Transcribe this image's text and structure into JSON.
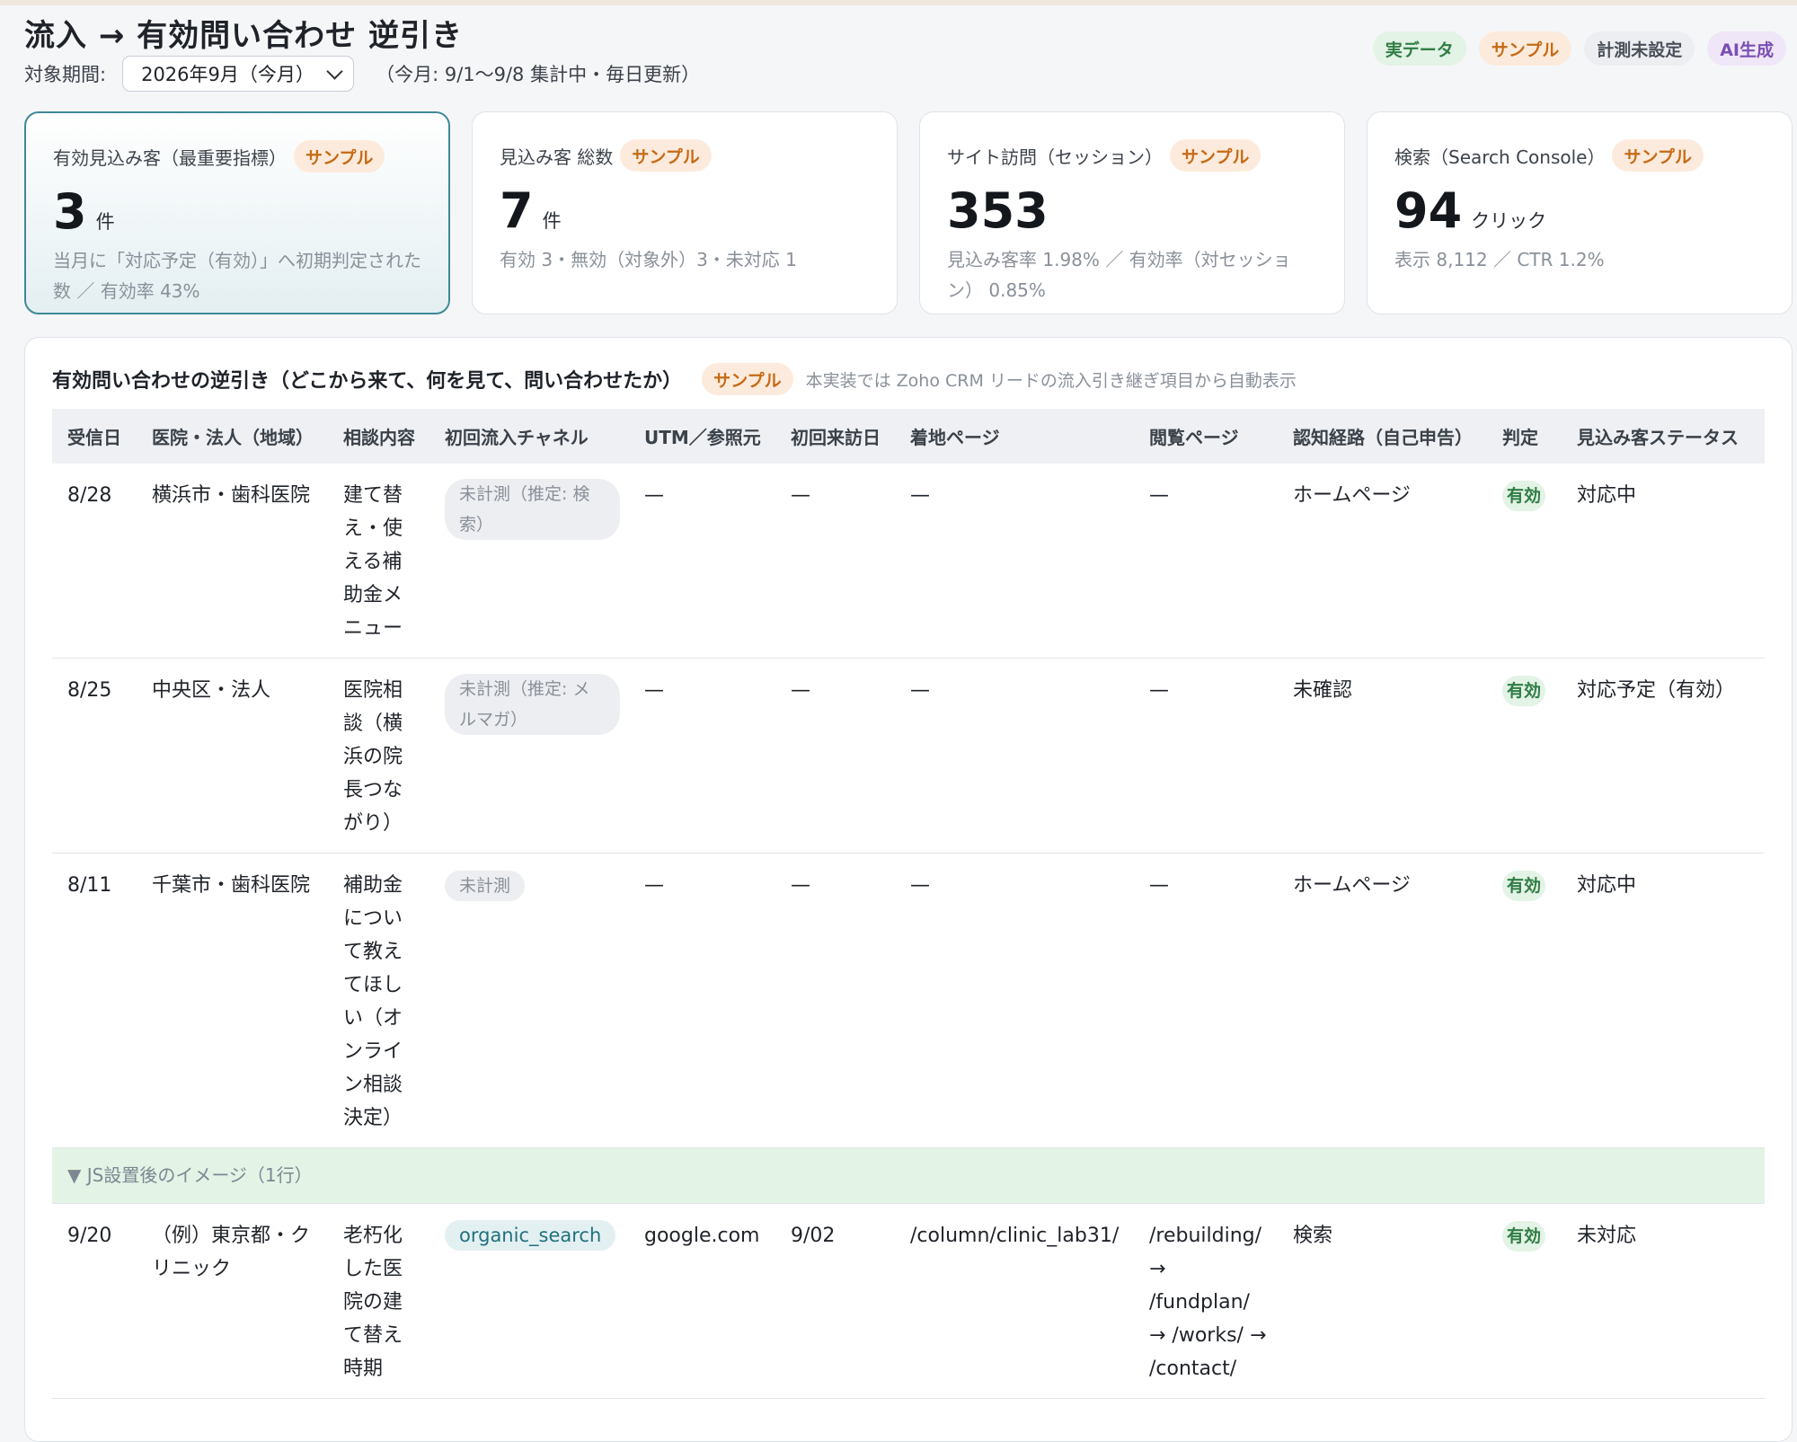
{
  "page": {
    "title": "流入 → 有効問い合わせ 逆引き",
    "period_label": "対象期間:",
    "period_value": "2026年9月（今月）",
    "period_note": "（今月: 9/1〜9/8 集計中・毎日更新）"
  },
  "legend": {
    "real": "実データ",
    "sample": "サンプル",
    "unset": "計測未設定",
    "ai": "AI生成"
  },
  "kpis": [
    {
      "label": "有効見込み客（最重要指標）",
      "badge": "サンプル",
      "value": "3",
      "unit": "件",
      "sub": "当月に「対応予定（有効）」へ初期判定された数 ／ 有効率 43%"
    },
    {
      "label": "見込み客 総数",
      "badge": "サンプル",
      "value": "7",
      "unit": "件",
      "sub": "有効 3・無効（対象外）3・未対応 1"
    },
    {
      "label": "サイト訪問（セッション）",
      "badge": "サンプル",
      "value": "353",
      "unit": "",
      "sub": "見込み客率 1.98% ／ 有効率（対セッション） 0.85%"
    },
    {
      "label": "検索（Search Console）",
      "badge": "サンプル",
      "value": "94",
      "unit": "クリック",
      "sub": "表示 8,112 ／ CTR 1.2%"
    }
  ],
  "panel": {
    "title": "有効問い合わせの逆引き（どこから来て、何を見て、問い合わせたか）",
    "badge": "サンプル",
    "note": "本実装では Zoho CRM リードの流入引き継ぎ項目から自動表示"
  },
  "table": {
    "headers": [
      "受信日",
      "医院・法人（地域）",
      "相談内容",
      "初回流入チャネル",
      "UTM／参照元",
      "初回来訪日",
      "着地ページ",
      "閲覧ページ",
      "認知経路（自己申告）",
      "判定",
      "見込み客ステータス"
    ],
    "rows": [
      {
        "date": "8/28",
        "org": "横浜市・歯科医院",
        "topic": "建て替え・使える補助金メニュー",
        "channel": "未計測（推定: 検索）",
        "utm": "—",
        "first_visit": "—",
        "landing": "—",
        "viewed": "—",
        "awareness": "ホームページ",
        "verdict": "有効",
        "status": "対応中"
      },
      {
        "date": "8/25",
        "org": "中央区・法人",
        "topic": "医院相談（横浜の院長つながり）",
        "channel": "未計測（推定: メルマガ）",
        "utm": "—",
        "first_visit": "—",
        "landing": "—",
        "viewed": "—",
        "awareness": "未確認",
        "verdict": "有効",
        "status": "対応予定（有効）"
      },
      {
        "date": "8/11",
        "org": "千葉市・歯科医院",
        "topic": "補助金について教えてほしい（オンライン相談決定）",
        "channel": "未計測",
        "utm": "—",
        "first_visit": "—",
        "landing": "—",
        "viewed": "—",
        "awareness": "ホームページ",
        "verdict": "有効",
        "status": "対応中"
      }
    ],
    "separator": "▼ JS設置後のイメージ（1行）",
    "example_row": {
      "date": "9/20",
      "org": "（例）東京都・クリニック",
      "topic": "老朽化した医院の建て替え時期",
      "channel": "organic_search",
      "utm": "google.com",
      "first_visit": "9/02",
      "landing": "/column/clinic_lab31/",
      "viewed": "/rebuilding/ → /fundplan/ → /works/ → /contact/",
      "awareness": "検索",
      "verdict": "有効",
      "status": "未対応"
    }
  }
}
